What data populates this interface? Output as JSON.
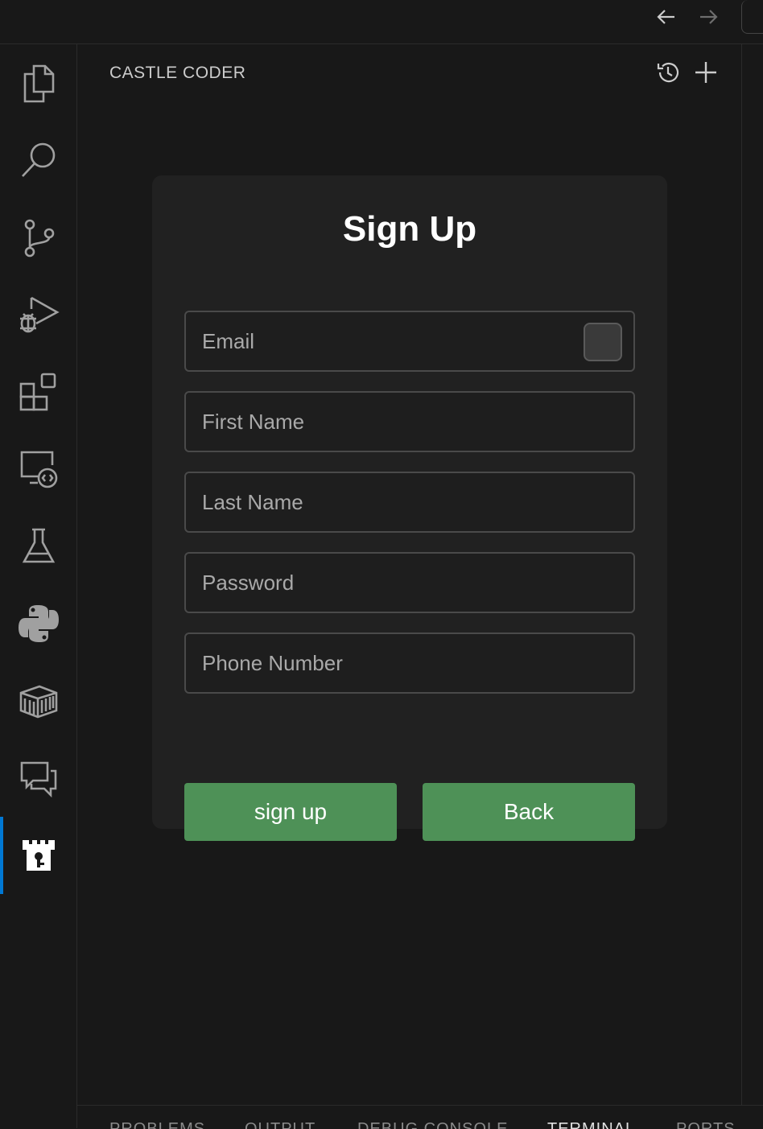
{
  "sidebar": {
    "title": "CASTLE CODER"
  },
  "form": {
    "title": "Sign Up",
    "fields": {
      "email": {
        "placeholder": "Email",
        "value": ""
      },
      "first_name": {
        "placeholder": "First Name",
        "value": ""
      },
      "last_name": {
        "placeholder": "Last Name",
        "value": ""
      },
      "password": {
        "placeholder": "Password",
        "value": ""
      },
      "phone": {
        "placeholder": "Phone Number",
        "value": ""
      }
    },
    "signup_label": "sign up",
    "back_label": "Back"
  },
  "activity_bar": {
    "items": [
      "files-icon",
      "search-icon",
      "source-control-icon",
      "run-debug-icon",
      "extensions-icon",
      "remote-explorer-icon",
      "testing-icon",
      "python-icon",
      "containers-icon",
      "chat-icon",
      "castle-icon"
    ],
    "active": "castle-icon"
  },
  "bottom_panel": {
    "tabs": [
      "PROBLEMS",
      "OUTPUT",
      "DEBUG CONSOLE",
      "TERMINAL",
      "PORTS"
    ],
    "active": "TERMINAL"
  },
  "colors": {
    "accent_button": "#4e9157",
    "active_indicator": "#0078d4",
    "background": "#181818",
    "card": "#212121"
  }
}
